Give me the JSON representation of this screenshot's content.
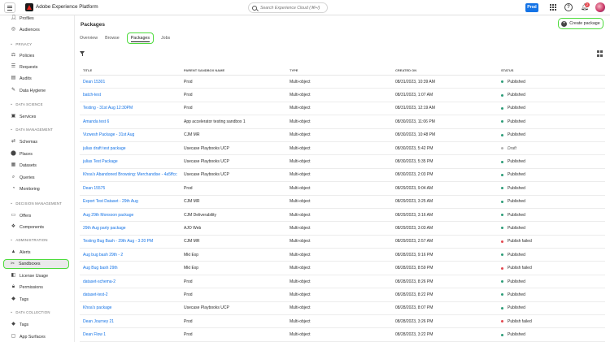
{
  "app": {
    "title": "Adobe Experience Platform"
  },
  "search": {
    "placeholder": "Search Experience Cloud (⌘+/)"
  },
  "toolbar": {
    "sandbox_label": "Prod",
    "notification_count": "2"
  },
  "sidebar": {
    "partial_items": [
      {
        "label": "Profiles",
        "icon": "profiles-icon"
      },
      {
        "label": "Audiences",
        "icon": "audiences-icon"
      }
    ],
    "sections": [
      {
        "title": "PRIVACY",
        "items": [
          {
            "label": "Policies",
            "icon": "policies-icon"
          },
          {
            "label": "Requests",
            "icon": "requests-icon"
          },
          {
            "label": "Audits",
            "icon": "audits-icon"
          },
          {
            "label": "Data Hygiene",
            "icon": "data-hygiene-icon"
          }
        ]
      },
      {
        "title": "DATA SCIENCE",
        "items": [
          {
            "label": "Services",
            "icon": "services-icon"
          }
        ]
      },
      {
        "title": "DATA MANAGEMENT",
        "items": [
          {
            "label": "Schemas",
            "icon": "schemas-icon"
          },
          {
            "label": "Places",
            "icon": "places-icon"
          },
          {
            "label": "Datasets",
            "icon": "datasets-icon"
          },
          {
            "label": "Queries",
            "icon": "queries-icon"
          },
          {
            "label": "Monitoring",
            "icon": "monitoring-icon"
          }
        ]
      },
      {
        "title": "DECISION MANAGEMENT",
        "items": [
          {
            "label": "Offers",
            "icon": "offers-icon"
          },
          {
            "label": "Components",
            "icon": "components-icon"
          }
        ]
      },
      {
        "title": "ADMINISTRATION",
        "items": [
          {
            "label": "Alerts",
            "icon": "alerts-icon"
          },
          {
            "label": "Sandboxes",
            "icon": "sandboxes-icon",
            "selected": true
          },
          {
            "label": "License Usage",
            "icon": "license-usage-icon"
          },
          {
            "label": "Permissions",
            "icon": "permissions-icon"
          },
          {
            "label": "Tags",
            "icon": "tags-icon"
          }
        ]
      },
      {
        "title": "DATA COLLECTION",
        "items": [
          {
            "label": "Tags",
            "icon": "tags-icon"
          },
          {
            "label": "App Surfaces",
            "icon": "app-surfaces-icon"
          }
        ]
      }
    ]
  },
  "main": {
    "page_title": "Packages",
    "create_button": "Create package",
    "tabs": [
      {
        "label": "Overview"
      },
      {
        "label": "Browse"
      },
      {
        "label": "Packages",
        "active": true
      },
      {
        "label": "Jobs"
      }
    ],
    "table": {
      "headers": [
        "TITLE",
        "PARENT SANDBOX NAME",
        "TYPE",
        "CREATED ON",
        "STATUS"
      ],
      "rows": [
        [
          "Dean 15301",
          "Prod",
          "Multi-object",
          "08/31/2023, 10:39 AM",
          "Published"
        ],
        [
          "batch-test",
          "Prod",
          "Multi-object",
          "08/31/2023, 1:07 AM",
          "Published"
        ],
        [
          "Testing - 31st Aug 12:30PM",
          "Prod",
          "Multi-object",
          "08/31/2023, 12:19 AM",
          "Published"
        ],
        [
          "Amanda test 6",
          "App accelerator testing sandbox 1",
          "Multi-object",
          "08/30/2023, 11:06 PM",
          "Published"
        ],
        [
          "Vizwesh Package - 31st Aug",
          "CJM MR",
          "Multi-object",
          "08/30/2023, 10:48 PM",
          "Published"
        ],
        [
          "julias draft test package",
          "Usecase Playbooks UCP",
          "Multi-object",
          "08/30/2023, 5:42 PM",
          "Draft"
        ],
        [
          "julias Test Package",
          "Usecase Playbooks UCP",
          "Multi-object",
          "08/30/2023, 5:35 PM",
          "Published"
        ],
        [
          "Khoa's Abandoned Browsing: Merchandise - 4a5ffcc",
          "Usecase Playbooks UCP",
          "Multi-object",
          "08/30/2023, 2:03 PM",
          "Published"
        ],
        [
          "Dean 15575",
          "Prod",
          "Multi-object",
          "08/29/2023, 9:04 AM",
          "Published"
        ],
        [
          "Export Test Dataset - 29th Aug",
          "CJM MR",
          "Multi-object",
          "08/29/2023, 3:25 AM",
          "Published"
        ],
        [
          "Aug 29th Monsoon package",
          "CJM Deliverability",
          "Multi-object",
          "08/29/2023, 3:16 AM",
          "Published"
        ],
        [
          "29th Aug party package",
          "AJO Web",
          "Multi-object",
          "08/29/2023, 3:03 AM",
          "Published"
        ],
        [
          "Testing Bug Bash - 29th Aug - 3:20 PM",
          "CJM MR",
          "Multi-object",
          "08/29/2023, 2:57 AM",
          "Publish failed"
        ],
        [
          "Aug bug bash 29th - 2",
          "Mkt Exp",
          "Multi-object",
          "08/28/2023, 9:16 PM",
          "Published"
        ],
        [
          "Aug Bug bash 29th",
          "Mkt Exp",
          "Multi-object",
          "08/28/2023, 8:59 PM",
          "Publish failed"
        ],
        [
          "dataset-schema-2",
          "Prod",
          "Multi-object",
          "08/28/2023, 8:26 PM",
          "Published"
        ],
        [
          "dataset-test-2",
          "Prod",
          "Multi-object",
          "08/28/2023, 8:22 PM",
          "Published"
        ],
        [
          "Khoa's package",
          "Usecase Playbooks UCP",
          "Multi-object",
          "08/28/2023, 8:07 PM",
          "Published"
        ],
        [
          "Dean Journey 21",
          "Prod",
          "Multi-object",
          "08/28/2023, 3:26 PM",
          "Publish failed"
        ],
        [
          "Dean Flow 1",
          "Prod",
          "Multi-object",
          "08/28/2023, 3:22 PM",
          "Published"
        ]
      ]
    }
  },
  "status_colors": {
    "Published": "#2d9d78",
    "Draft": "#b3b3b3",
    "Publish failed": "#e34850"
  },
  "highlight_color": "#4ddb3c",
  "accent_color": "#1473e6"
}
